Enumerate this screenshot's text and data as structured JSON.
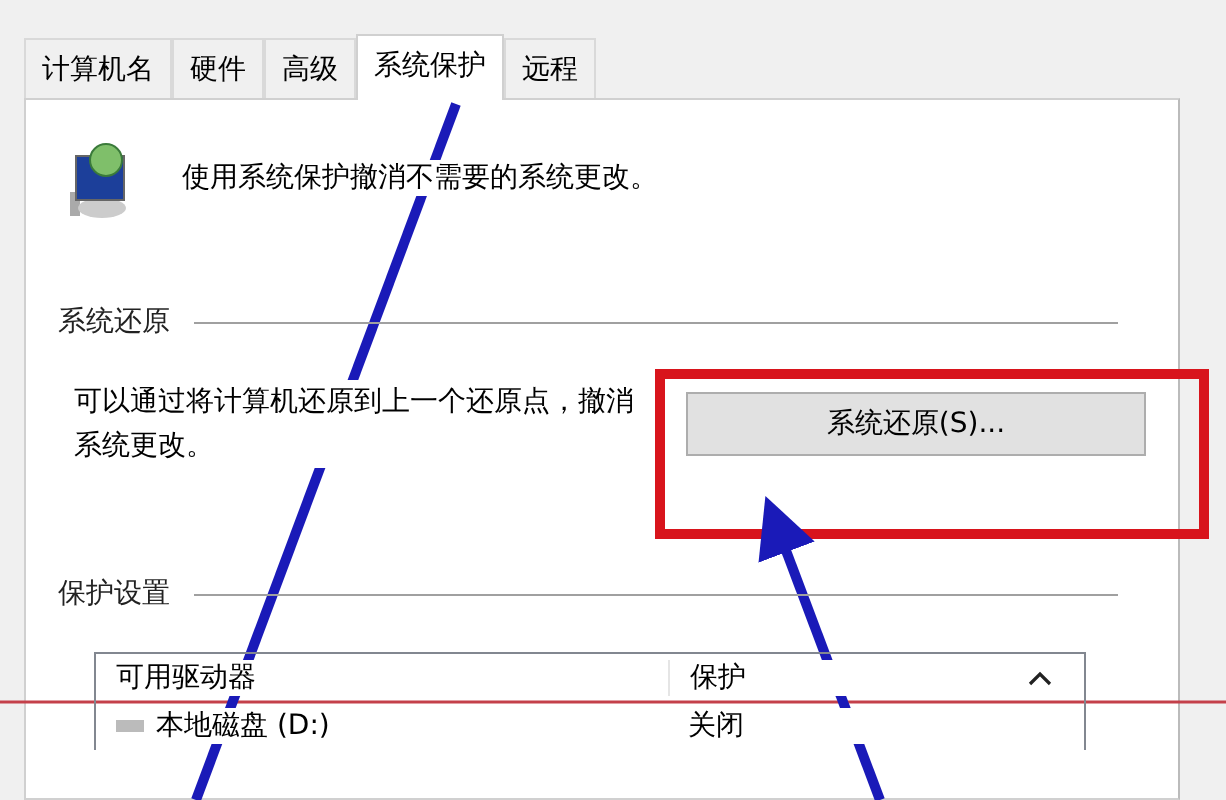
{
  "tabs": [
    {
      "label": "计算机名",
      "selected": false
    },
    {
      "label": "硬件",
      "selected": false
    },
    {
      "label": "高级",
      "selected": false
    },
    {
      "label": "系统保护",
      "selected": true
    },
    {
      "label": "远程",
      "selected": false
    }
  ],
  "description": "使用系统保护撤消不需要的系统更改。",
  "system_restore": {
    "heading": "系统还原",
    "text": "可以通过将计算机还原到上一个还原点，撤消系统更改。",
    "button": "系统还原(S)..."
  },
  "protection_settings": {
    "heading": "保护设置",
    "columns": [
      "可用驱动器",
      "保护"
    ],
    "rows": [
      {
        "drive": "本地磁盘 (D:)",
        "protection": "关闭"
      }
    ]
  }
}
